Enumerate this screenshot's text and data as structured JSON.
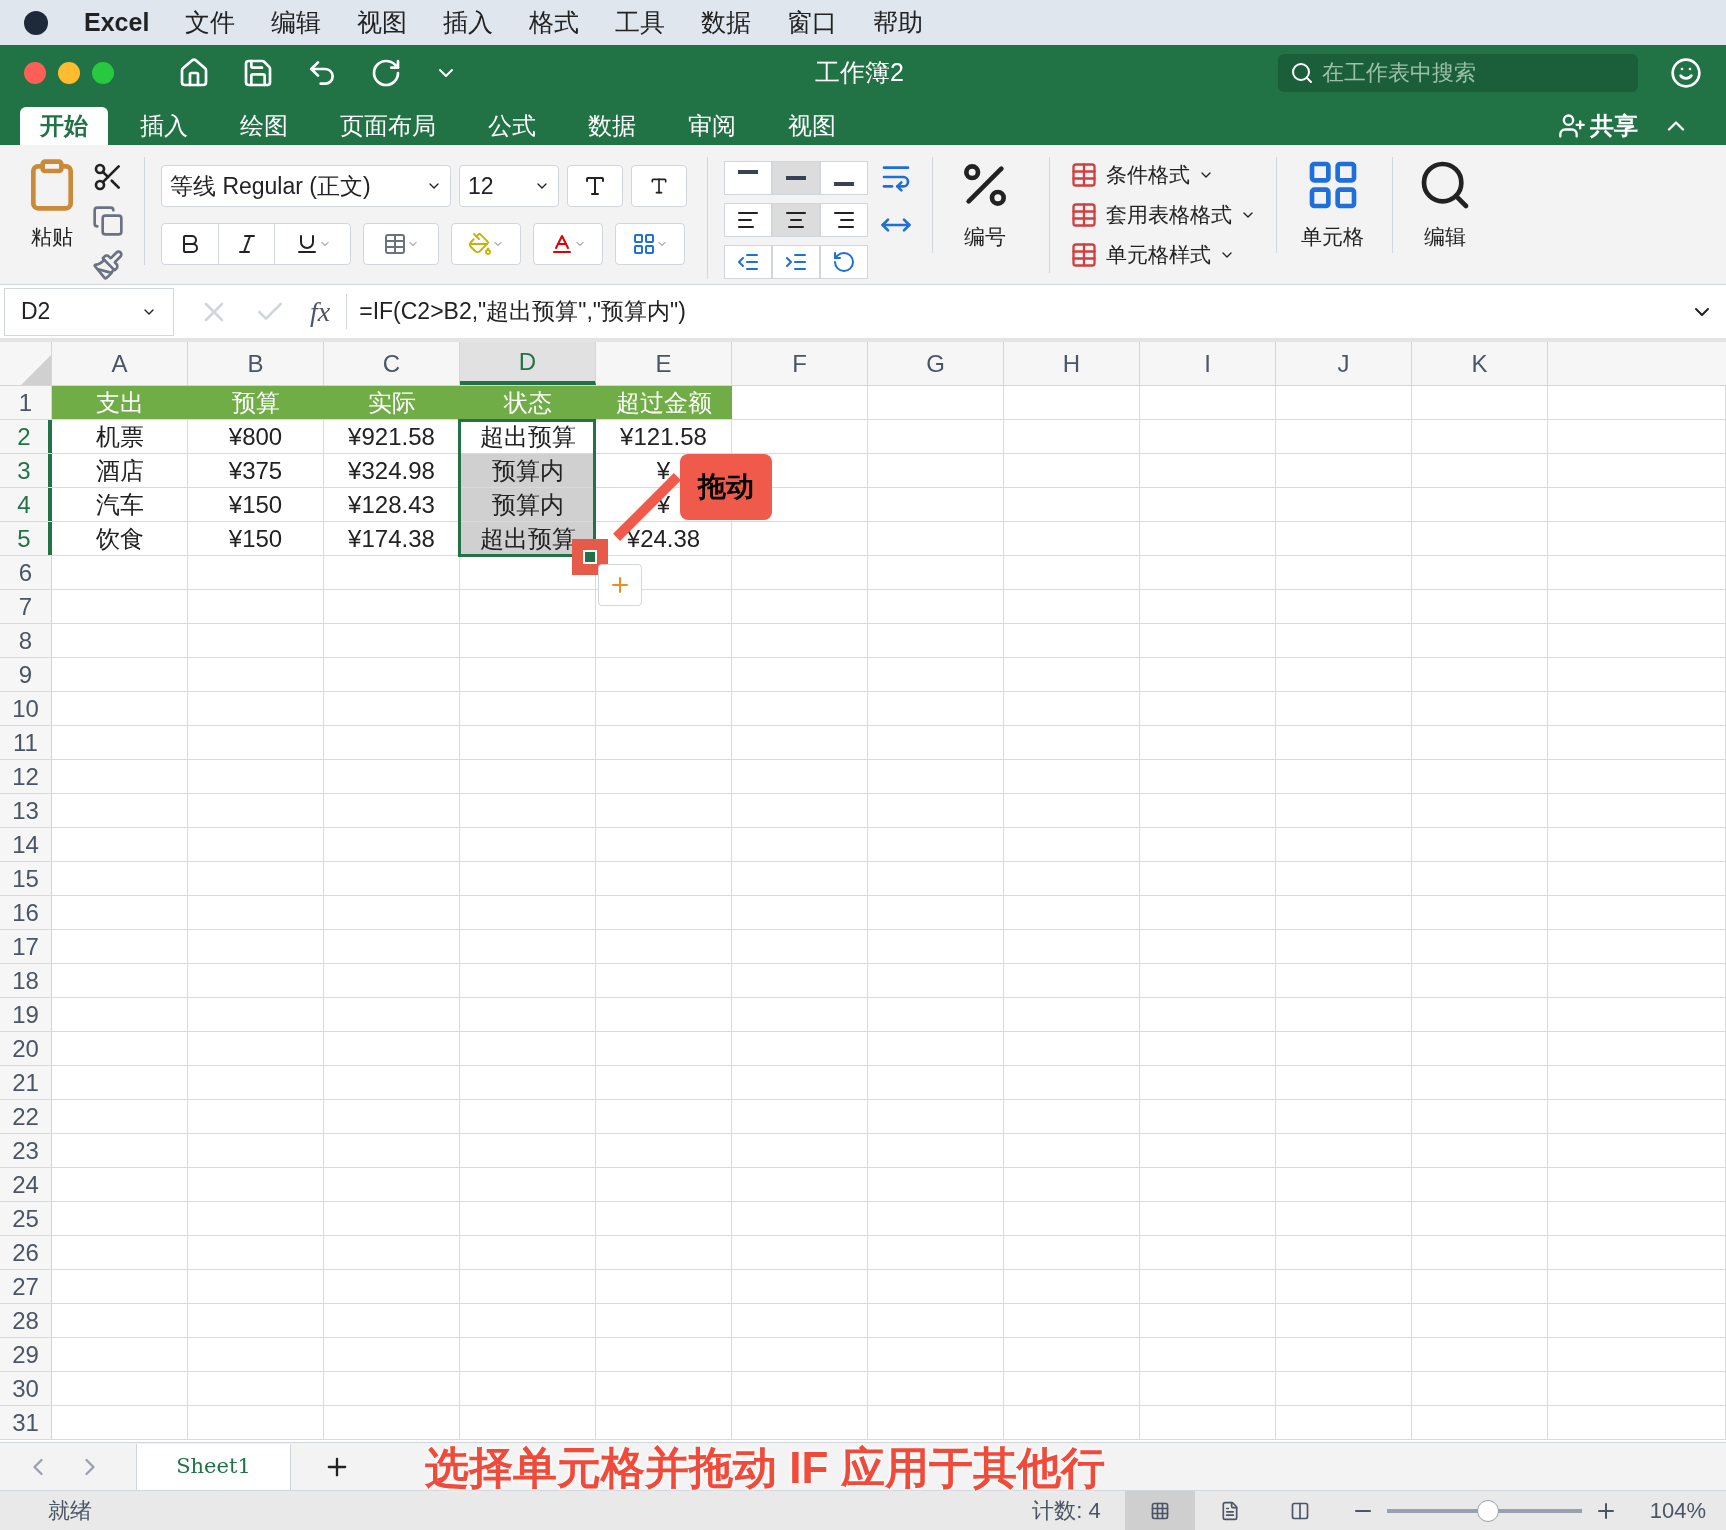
{
  "menu_bar": {
    "app": "Excel",
    "items": [
      "文件",
      "编辑",
      "视图",
      "插入",
      "格式",
      "工具",
      "数据",
      "窗口",
      "帮助"
    ]
  },
  "window": {
    "title": "工作簿2",
    "search": {
      "placeholder": "在工作表中搜索"
    }
  },
  "ribbon_tabs": [
    {
      "label": "开始",
      "selected": true
    },
    {
      "label": "插入",
      "selected": false
    },
    {
      "label": "绘图",
      "selected": false
    },
    {
      "label": "页面布局",
      "selected": false
    },
    {
      "label": "公式",
      "selected": false
    },
    {
      "label": "数据",
      "selected": false
    },
    {
      "label": "审阅",
      "selected": false
    },
    {
      "label": "视图",
      "selected": false
    }
  ],
  "share": "共享",
  "ribbon": {
    "paste": "粘贴",
    "font": "等线 Regular (正文)",
    "size": "12",
    "number": "编号",
    "styles": [
      "条件格式",
      "套用表格格式",
      "单元格样式"
    ],
    "cells": "单元格",
    "editing": "编辑"
  },
  "formula_bar": {
    "name_box": "D2",
    "function_label": "fx",
    "formula": "=IF(C2>B2,\"超出预算\",\"预算内\")"
  },
  "sheet": {
    "columns": [
      {
        "label": "A",
        "selected": false
      },
      {
        "label": "B",
        "selected": false
      },
      {
        "label": "C",
        "selected": false
      },
      {
        "label": "D",
        "selected": true
      },
      {
        "label": "E",
        "selected": false
      },
      {
        "label": "F",
        "selected": false
      },
      {
        "label": "G",
        "selected": false
      },
      {
        "label": "H",
        "selected": false
      },
      {
        "label": "I",
        "selected": false
      },
      {
        "label": "J",
        "selected": false
      },
      {
        "label": "K",
        "selected": false
      }
    ],
    "row_numbers": [
      {
        "label": "1",
        "selected": false
      },
      {
        "label": "2",
        "selected": true
      },
      {
        "label": "3",
        "selected": true
      },
      {
        "label": "4",
        "selected": true
      },
      {
        "label": "5",
        "selected": true
      },
      {
        "label": "6",
        "selected": false
      },
      {
        "label": "7",
        "selected": false
      },
      {
        "label": "8",
        "selected": false
      },
      {
        "label": "9",
        "selected": false
      },
      {
        "label": "10",
        "selected": false
      },
      {
        "label": "11",
        "selected": false
      },
      {
        "label": "12",
        "selected": false
      },
      {
        "label": "13",
        "selected": false
      },
      {
        "label": "14",
        "selected": false
      },
      {
        "label": "15",
        "selected": false
      },
      {
        "label": "16",
        "selected": false
      },
      {
        "label": "17",
        "selected": false
      },
      {
        "label": "18",
        "selected": false
      },
      {
        "label": "19",
        "selected": false
      },
      {
        "label": "20",
        "selected": false
      },
      {
        "label": "21",
        "selected": false
      },
      {
        "label": "22",
        "selected": false
      },
      {
        "label": "23",
        "selected": false
      },
      {
        "label": "24",
        "selected": false
      },
      {
        "label": "25",
        "selected": false
      },
      {
        "label": "26",
        "selected": false
      },
      {
        "label": "27",
        "selected": false
      },
      {
        "label": "28",
        "selected": false
      },
      {
        "label": "29",
        "selected": false
      },
      {
        "label": "30",
        "selected": false
      },
      {
        "label": "31",
        "selected": false
      }
    ],
    "rows": [
      {
        "kind": "header",
        "cells": [
          {
            "text": "支出"
          },
          {
            "text": "预算"
          },
          {
            "text": "实际"
          },
          {
            "text": "状态"
          },
          {
            "text": "超过金额"
          }
        ]
      },
      {
        "kind": "data",
        "cells": [
          {
            "text": "机票",
            "selected": false
          },
          {
            "text": "¥800",
            "selected": false
          },
          {
            "text": "¥921.58",
            "selected": false
          },
          {
            "text": "超出预算",
            "selected": false
          },
          {
            "text": "¥121.58",
            "selected": false
          }
        ]
      },
      {
        "kind": "data",
        "cells": [
          {
            "text": "酒店",
            "selected": false
          },
          {
            "text": "¥375",
            "selected": false
          },
          {
            "text": "¥324.98",
            "selected": false
          },
          {
            "text": "预算内",
            "selected": true
          },
          {
            "text": "¥",
            "selected": false
          }
        ]
      },
      {
        "kind": "data",
        "cells": [
          {
            "text": "汽车",
            "selected": false
          },
          {
            "text": "¥150",
            "selected": false
          },
          {
            "text": "¥128.43",
            "selected": false
          },
          {
            "text": "预算内",
            "selected": true
          },
          {
            "text": "¥",
            "selected": false
          }
        ]
      },
      {
        "kind": "data",
        "cells": [
          {
            "text": "饮食",
            "selected": false
          },
          {
            "text": "¥150",
            "selected": false
          },
          {
            "text": "¥174.38",
            "selected": false
          },
          {
            "text": "超出预算",
            "selected": true
          },
          {
            "text": "¥24.38",
            "selected": false
          }
        ]
      }
    ]
  },
  "callout": "拖动",
  "sheet_tabs": [
    {
      "label": "Sheet1",
      "selected": true
    }
  ],
  "caption": "选择单元格并拖动 IF 应用于其他行",
  "status_bar": {
    "status": "就绪",
    "count": "计数: 4",
    "view_buttons": [
      {
        "kind": "normal",
        "selected": true
      },
      {
        "kind": "page_layout",
        "selected": false
      },
      {
        "kind": "page_break",
        "selected": false
      }
    ],
    "zoom_slider": {
      "level": 0.52
    },
    "zoom": "104%"
  }
}
